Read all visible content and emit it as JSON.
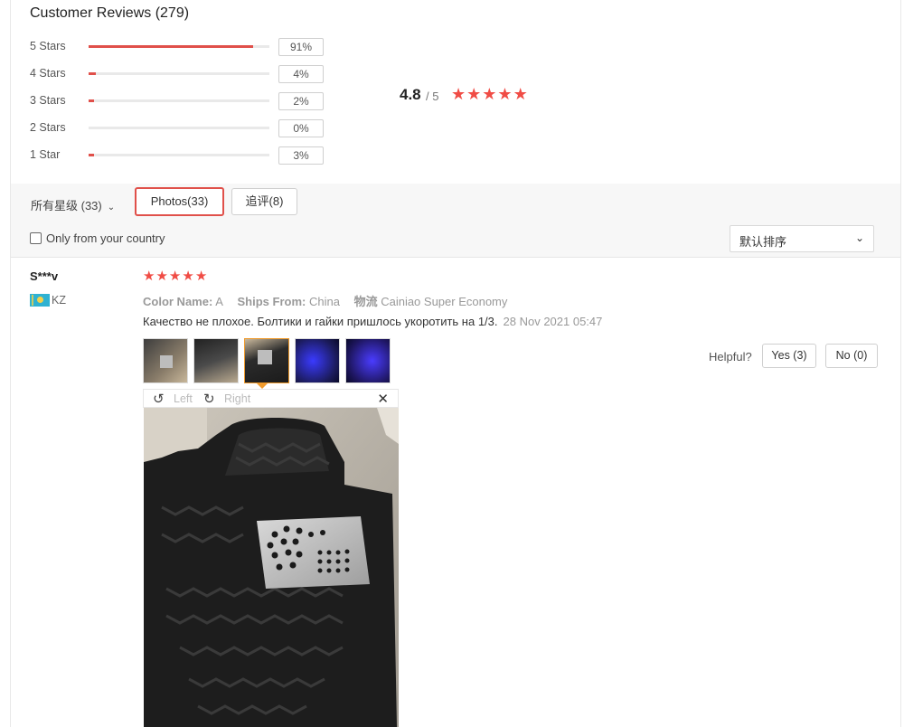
{
  "header": {
    "title": "Customer Reviews (279)"
  },
  "distribution": [
    {
      "label": "5 Stars",
      "percent": "91%",
      "fraction": 0.91
    },
    {
      "label": "4 Stars",
      "percent": "4%",
      "fraction": 0.04
    },
    {
      "label": "3 Stars",
      "percent": "2%",
      "fraction": 0.02
    },
    {
      "label": "2 Stars",
      "percent": "0%",
      "fraction": 0.0
    },
    {
      "label": "1 Star",
      "percent": "3%",
      "fraction": 0.03
    }
  ],
  "summary": {
    "average": "4.8",
    "max": "/ 5",
    "stars": 5
  },
  "filters": {
    "all_stars": "所有星级 (33)",
    "photos": "Photos(33)",
    "follow_up": "追评(8)",
    "only_country": "Only from your country",
    "sort_value": "默认排序"
  },
  "review": {
    "name": "S***v",
    "country": "KZ",
    "stars": 5,
    "color_label": "Color Name:",
    "color_value": "A",
    "ships_label": "Ships From:",
    "ships_value": "China",
    "logistics_label": "物流",
    "logistics_value": "Cainiao Super Economy",
    "text": "Качество не плохое. Болтики и гайки пришлось укоротить на 1/3.",
    "date": "28 Nov 2021 05:47",
    "helpful_label": "Helpful?",
    "yes": "Yes (3)",
    "no": "No (0)"
  },
  "viewer": {
    "left": "Left",
    "right": "Right"
  },
  "colors": {
    "accent": "#e0504a",
    "star": "#f04c45",
    "active_thumb": "#f09a2b"
  },
  "icons": [
    "chevron-down-icon",
    "rotate-left-icon",
    "rotate-right-icon",
    "close-icon",
    "star-icon",
    "flag-kz-icon"
  ]
}
